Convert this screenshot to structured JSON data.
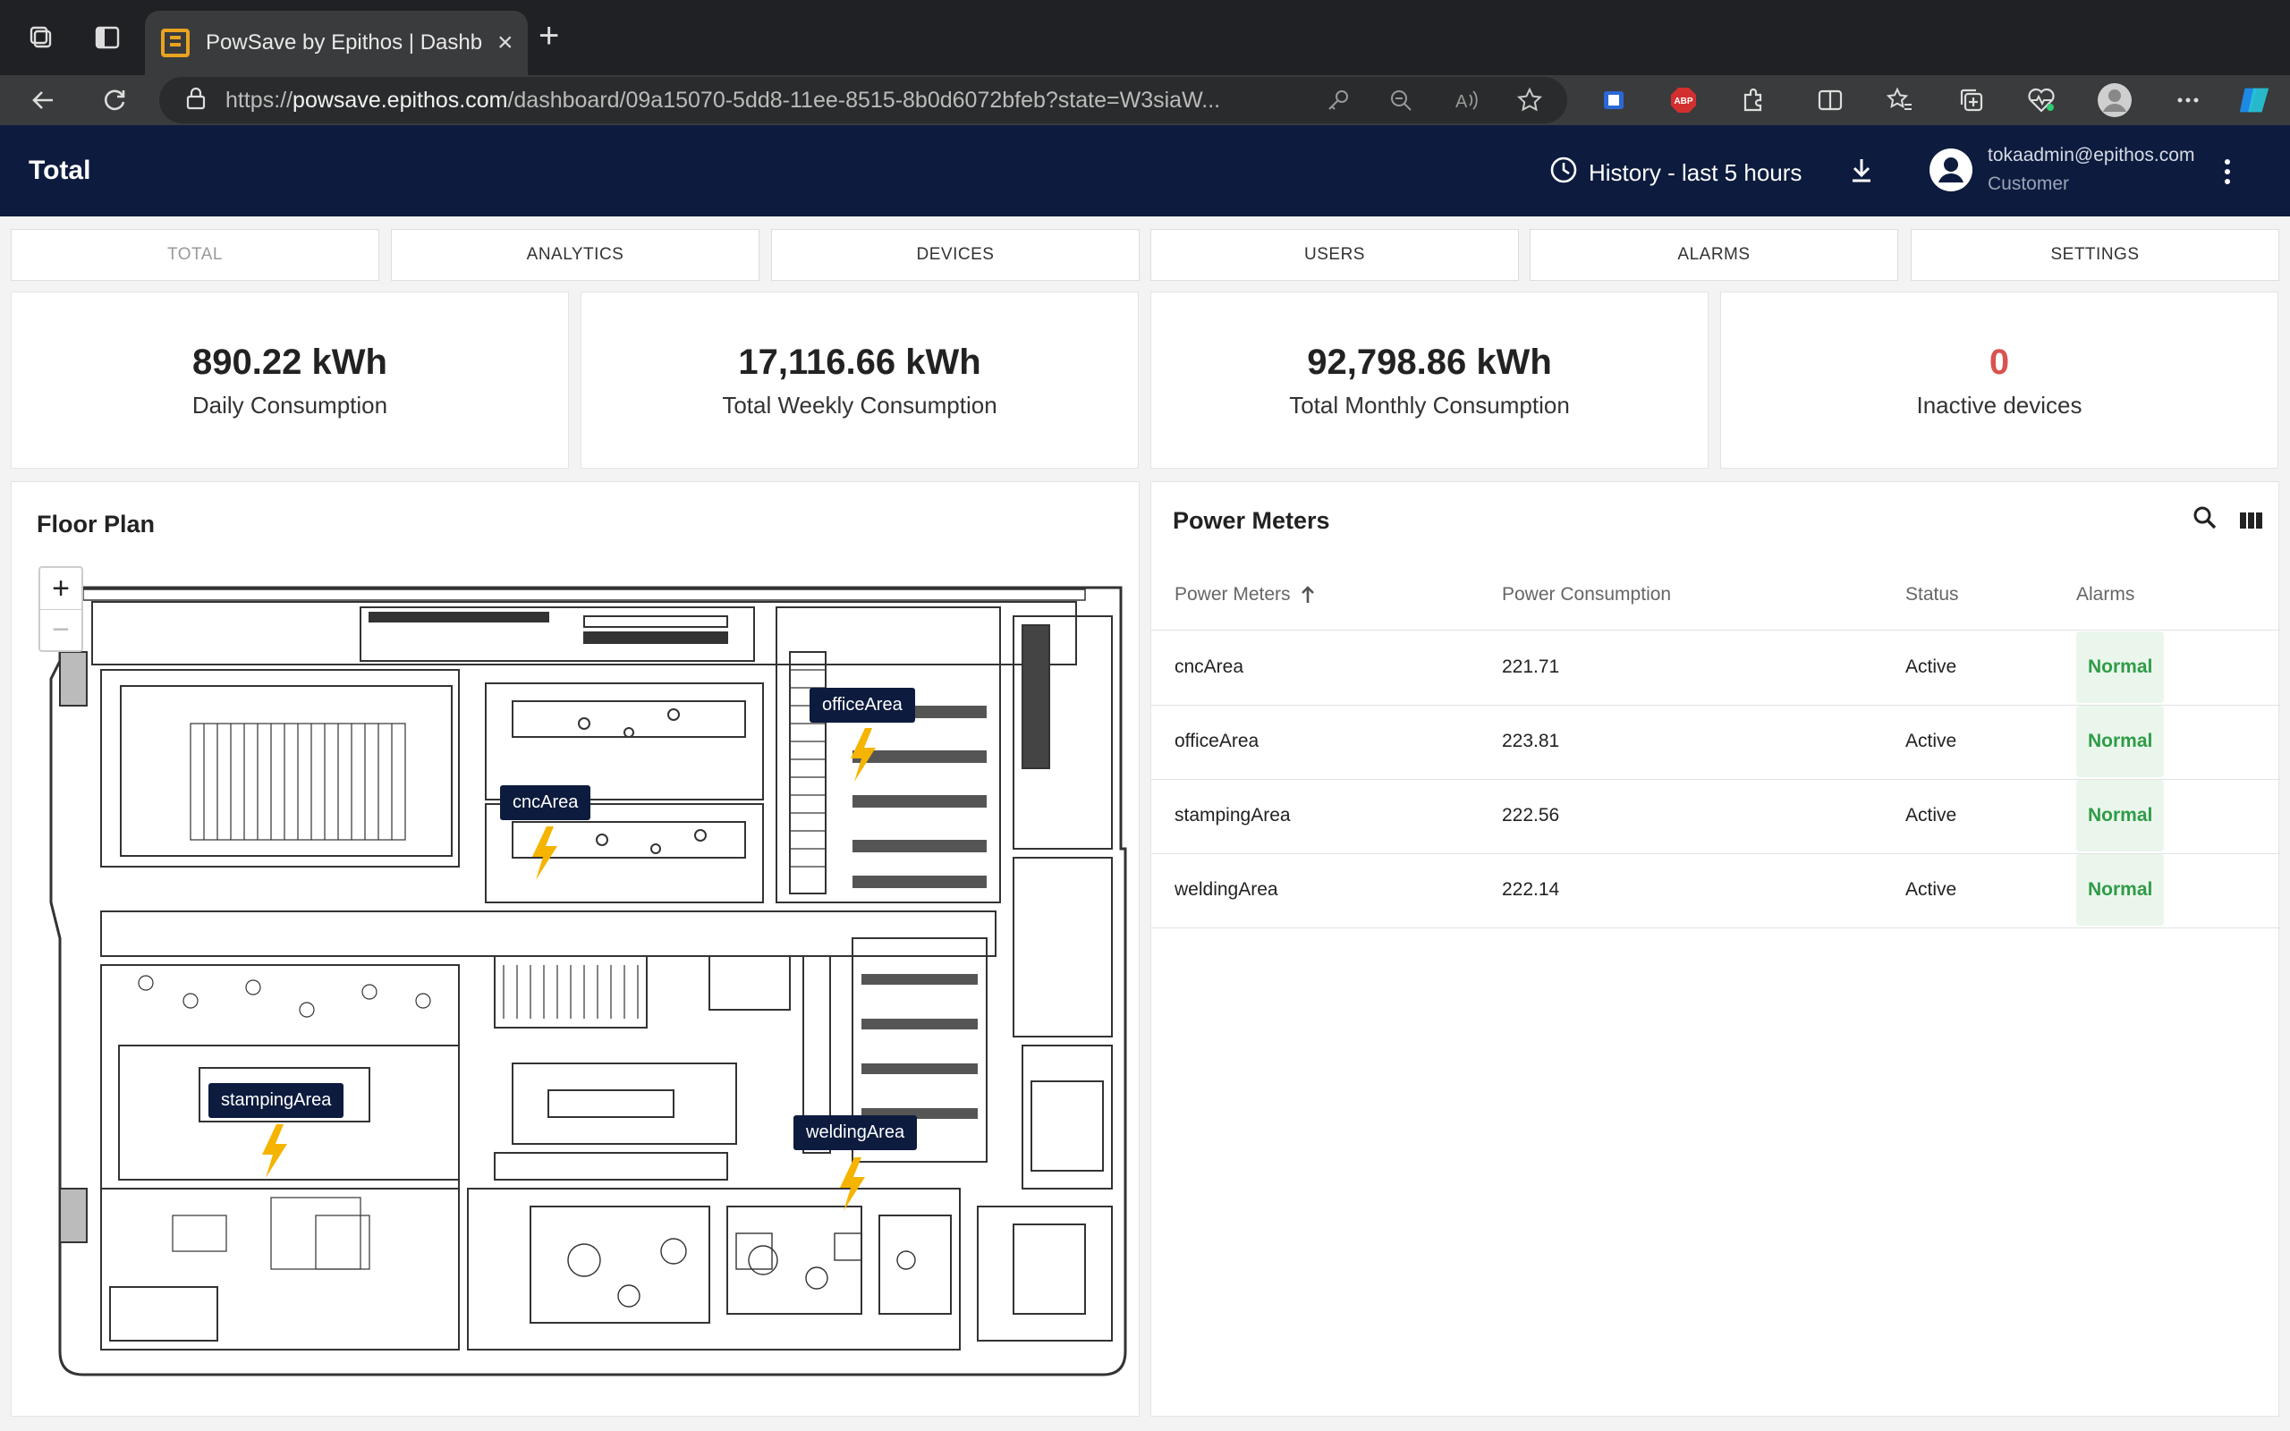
{
  "browser": {
    "tab_title": "PowSave by Epithos | Dashboard",
    "url_scheme": "https://",
    "url_host": "powsave.epithos.com",
    "url_path": "/dashboard/09a15070-5dd8-11ee-8515-8b0d6072bfeb?state=W3siaW..."
  },
  "header": {
    "title": "Total",
    "history_label": "History - last 5 hours",
    "user_email": "tokaadmin@epithos.com",
    "user_role": "Customer"
  },
  "nav_tabs": [
    "TOTAL",
    "ANALYTICS",
    "DEVICES",
    "USERS",
    "ALARMS",
    "SETTINGS"
  ],
  "kpis": [
    {
      "value": "890.22 kWh",
      "label": "Daily Consumption"
    },
    {
      "value": "17,116.66 kWh",
      "label": "Total Weekly Consumption"
    },
    {
      "value": "92,798.86 kWh",
      "label": "Total Monthly Consumption"
    },
    {
      "value": "0",
      "label": "Inactive devices",
      "color": "#d9534f"
    }
  ],
  "floor_plan": {
    "title": "Floor Plan",
    "zoom_in": "+",
    "zoom_out": "−",
    "markers": [
      "cncArea",
      "officeArea",
      "stampingArea",
      "weldingArea"
    ]
  },
  "power_meters": {
    "title": "Power Meters",
    "columns": [
      "Power Meters",
      "Power Consumption",
      "Status",
      "Alarms"
    ],
    "rows": [
      {
        "name": "cncArea",
        "consumption": "221.71",
        "status": "Active",
        "alarm": "Normal"
      },
      {
        "name": "officeArea",
        "consumption": "223.81",
        "status": "Active",
        "alarm": "Normal"
      },
      {
        "name": "stampingArea",
        "consumption": "222.56",
        "status": "Active",
        "alarm": "Normal"
      },
      {
        "name": "weldingArea",
        "consumption": "222.14",
        "status": "Active",
        "alarm": "Normal"
      }
    ]
  },
  "colors": {
    "app_bar": "#0c1b3e",
    "badge_text": "#2e9c46",
    "badge_bg": "#eaf6ec",
    "bolt": "#f5b400"
  }
}
